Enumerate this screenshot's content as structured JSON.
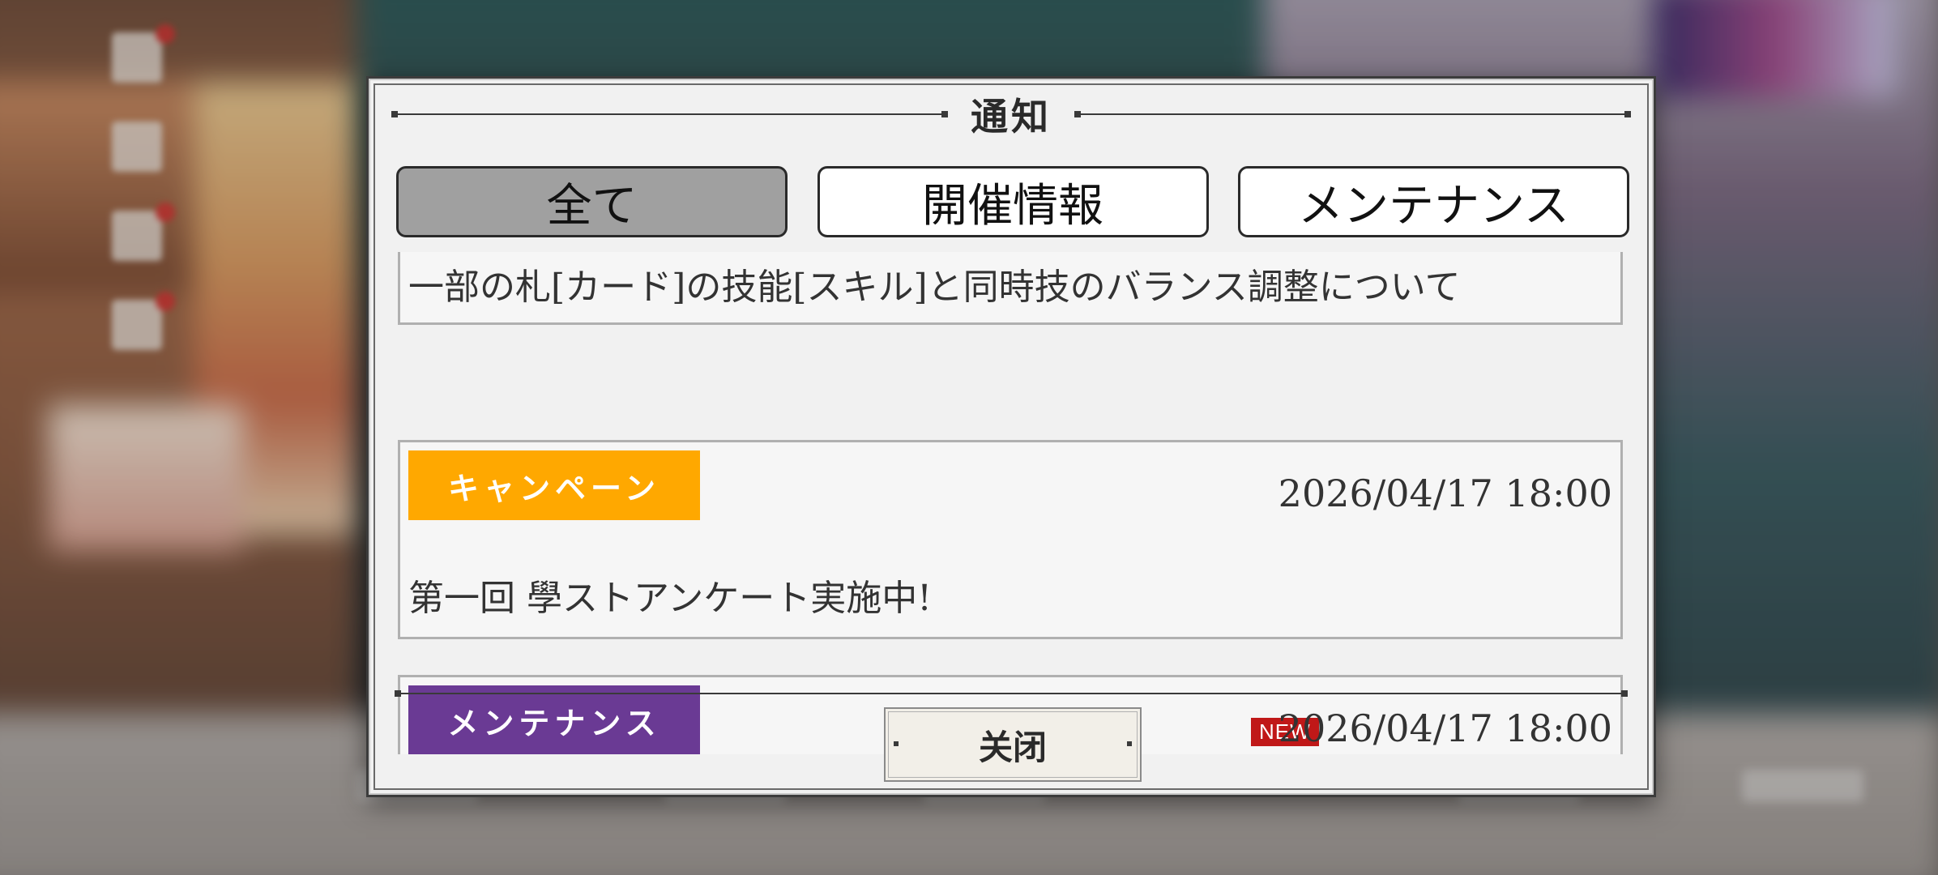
{
  "modal": {
    "title": "通知",
    "tabs": [
      {
        "label": "全て",
        "active": true
      },
      {
        "label": "開催情報",
        "active": false
      },
      {
        "label": "メンテナンス",
        "active": false
      }
    ],
    "notices": [
      {
        "category": "",
        "category_color": "",
        "is_new": false,
        "date": "",
        "title": "一部の札[カード]の技能[スキル]と同時技のバランス調整について"
      },
      {
        "category": "キャンペーン",
        "category_color": "#ffa800",
        "is_new": false,
        "date": "2026/04/17 18:00",
        "title": "第一回 學ストアンケート実施中!"
      },
      {
        "category": "メンテナンス",
        "category_color": "#6a3a94",
        "is_new": true,
        "new_label": "NEW",
        "date": "2026/04/17 18:00",
        "title": ""
      }
    ],
    "close_label": "关闭"
  }
}
